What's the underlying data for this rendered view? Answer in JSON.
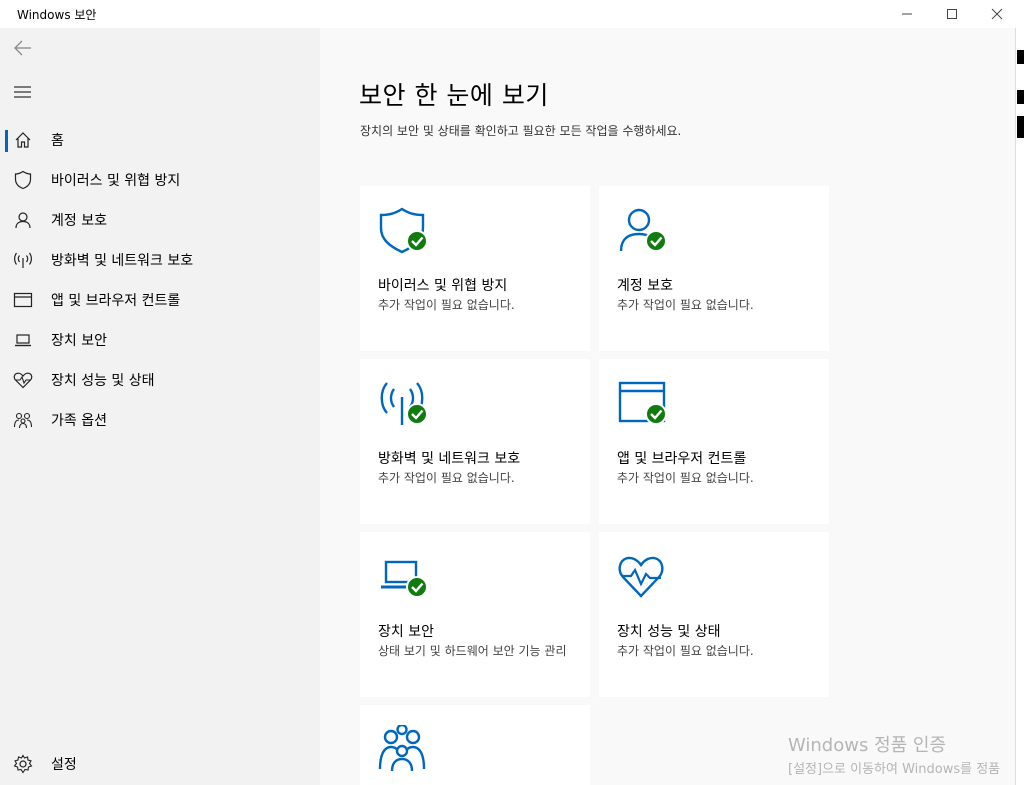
{
  "window": {
    "title": "Windows 보안",
    "minimize": "—",
    "maximize": "☐",
    "close": "✕"
  },
  "sidebar": {
    "back_icon": "back-arrow-icon",
    "menu_icon": "hamburger-icon",
    "items": [
      {
        "label": "홈",
        "icon": "home-icon"
      },
      {
        "label": "바이러스 및 위협 방지",
        "icon": "shield-icon"
      },
      {
        "label": "계정 보호",
        "icon": "person-icon"
      },
      {
        "label": "방화벽 및 네트워크 보호",
        "icon": "antenna-icon"
      },
      {
        "label": "앱 및 브라우저 컨트롤",
        "icon": "browser-window-icon"
      },
      {
        "label": "장치 보안",
        "icon": "laptop-icon"
      },
      {
        "label": "장치 성능 및 상태",
        "icon": "heart-pulse-icon"
      },
      {
        "label": "가족 옵션",
        "icon": "family-icon"
      }
    ],
    "settings_label": "설정",
    "settings_icon": "gear-icon"
  },
  "main": {
    "title": "보안 한 눈에 보기",
    "subtitle": "장치의 보안 및 상태를 확인하고 필요한 모든 작업을 수행하세요.",
    "cards": [
      {
        "title": "바이러스 및 위협 방지",
        "desc": "추가 작업이 필요 없습니다.",
        "icon": "shield-check-icon"
      },
      {
        "title": "계정 보호",
        "desc": "추가 작업이 필요 없습니다.",
        "icon": "person-check-icon"
      },
      {
        "title": "방화벽 및 네트워크 보호",
        "desc": "추가 작업이 필요 없습니다.",
        "icon": "antenna-check-icon"
      },
      {
        "title": "앱 및 브라우저 컨트롤",
        "desc": "추가 작업이 필요 없습니다.",
        "icon": "browser-check-icon"
      },
      {
        "title": "장치 보안",
        "desc": "상태 보기 및 하드웨어 보안 기능 관리",
        "icon": "laptop-check-icon"
      },
      {
        "title": "장치 성능 및 상태",
        "desc": "추가 작업이 필요 없습니다.",
        "icon": "heart-pulse-icon"
      },
      {
        "title": "",
        "desc": "",
        "icon": "family-icon"
      }
    ]
  },
  "watermark": {
    "line1": "Windows 정품 인증",
    "line2": "[설정]으로 이동하여 Windows를 정품"
  },
  "colors": {
    "accent": "#0067c0",
    "check": "#107c10",
    "sidebar_bg": "#f2f2f2",
    "main_bg": "#f9f9f9"
  }
}
